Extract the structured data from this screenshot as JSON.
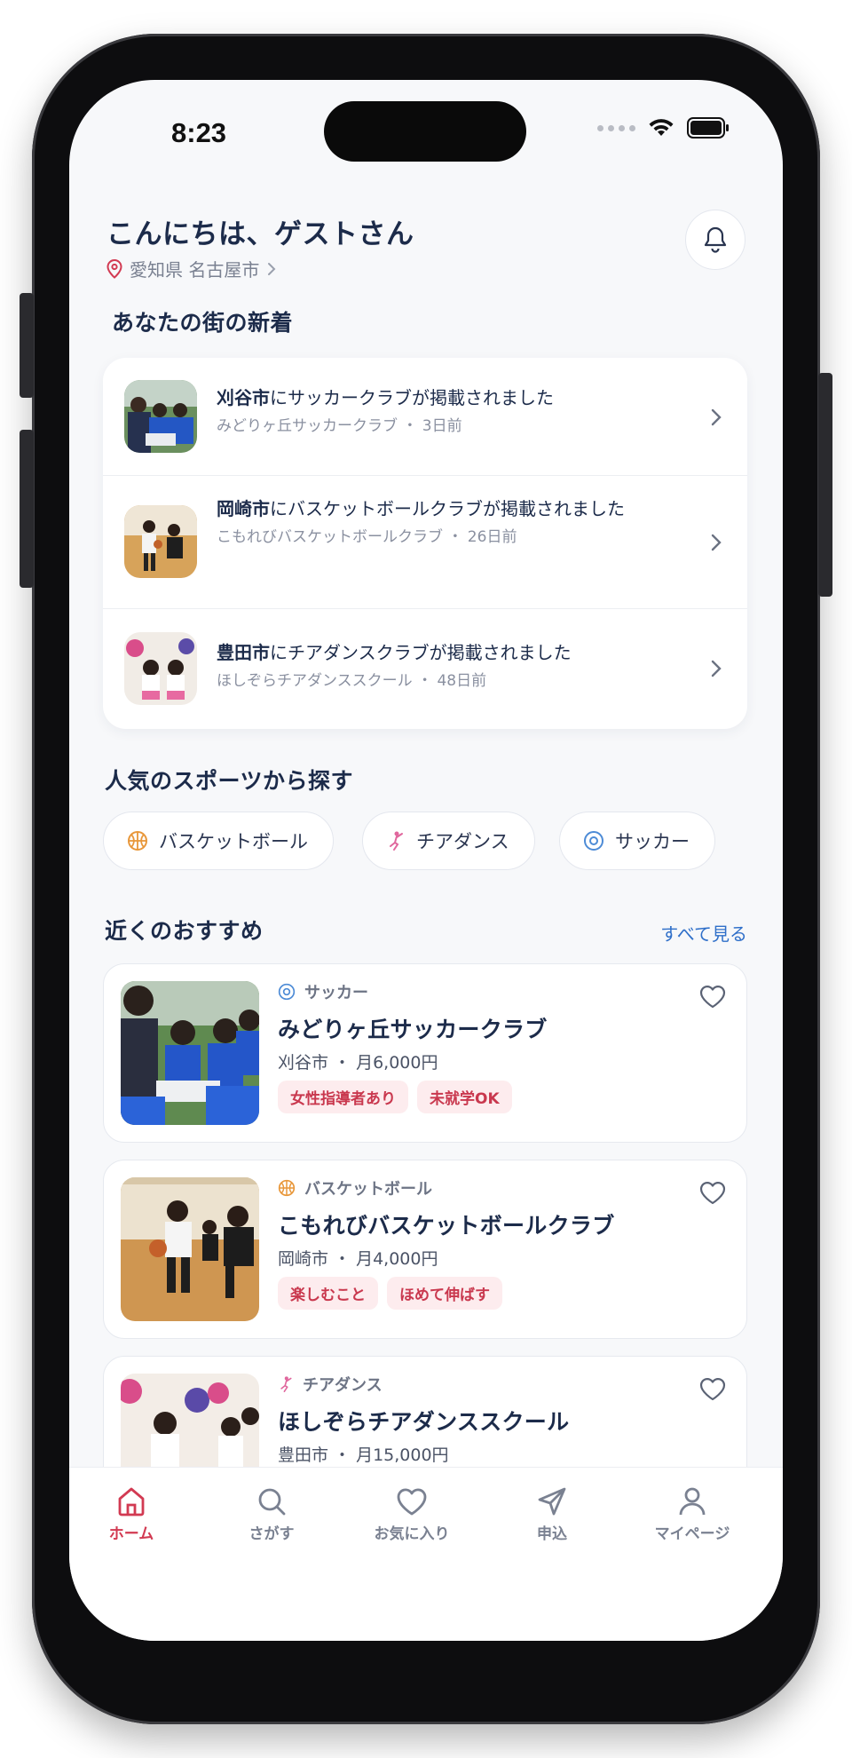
{
  "status": {
    "time": "8:23"
  },
  "header": {
    "greeting": "こんにちは、ゲストさん",
    "location": "愛知県 名古屋市"
  },
  "news": {
    "title": "あなたの街の新着",
    "items": [
      {
        "city": "刈谷市",
        "text": "にサッカークラブが掲載されました",
        "sub": "みどりヶ丘サッカークラブ ・ 3日前"
      },
      {
        "city": "岡崎市",
        "text": "にバスケットボールクラブが掲載されました",
        "sub": "こもれびバスケットボールクラブ ・ 26日前"
      },
      {
        "city": "豊田市",
        "text": "にチアダンスクラブが掲載されました",
        "sub": "ほしぞらチアダンススクール ・ 48日前"
      }
    ]
  },
  "sports": {
    "title": "人気のスポーツから探す",
    "chips": [
      {
        "label": "バスケットボール",
        "icon": "basketball-icon"
      },
      {
        "label": "チアダンス",
        "icon": "cheer-icon"
      },
      {
        "label": "サッカー",
        "icon": "soccer-icon"
      }
    ]
  },
  "recommend": {
    "title": "近くのおすすめ",
    "see_all": "すべて見る",
    "items": [
      {
        "sport": "サッカー",
        "name": "みどりヶ丘サッカークラブ",
        "meta": "刈谷市 ・ 月6,000円",
        "tags": [
          "女性指導者あり",
          "未就学OK"
        ]
      },
      {
        "sport": "バスケットボール",
        "name": "こもれびバスケットボールクラブ",
        "meta": "岡崎市 ・ 月4,000円",
        "tags": [
          "楽しむこと",
          "ほめて伸ばす"
        ]
      },
      {
        "sport": "チアダンス",
        "name": "ほしぞらチアダンススクール",
        "meta": "豊田市 ・ 月15,000円",
        "tags": []
      }
    ]
  },
  "tabs": [
    {
      "label": "ホーム"
    },
    {
      "label": "さがす"
    },
    {
      "label": "お気に入り"
    },
    {
      "label": "申込"
    },
    {
      "label": "マイページ"
    }
  ],
  "colors": {
    "accent": "#d23a52",
    "navy": "#1c2b4a",
    "link": "#2f6fc9",
    "tag_bg": "#fdecee"
  }
}
